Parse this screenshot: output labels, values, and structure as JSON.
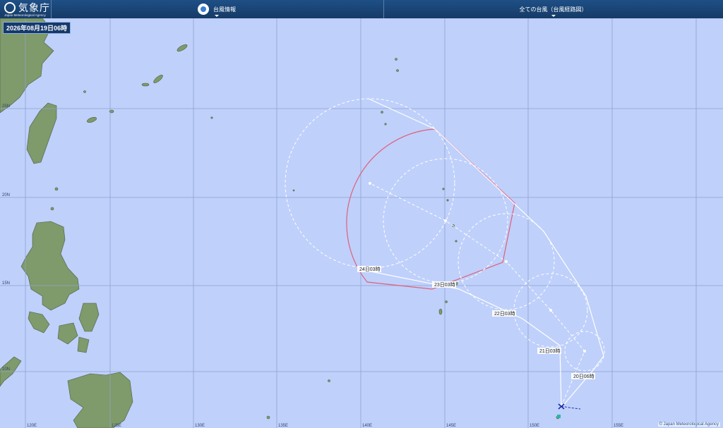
{
  "header": {
    "logo_ja": "気象庁",
    "logo_en": "Japan Meteorological Agency",
    "nav_typhoon_info": "台風情報",
    "nav_all_typhoons": "全ての台風（台風経路図）"
  },
  "timestamp": "2026年08月19日06時",
  "credit": "© Japan Meteorological Agency",
  "map": {
    "lon_labels": [
      "120E",
      "125E",
      "130E",
      "135E",
      "140E",
      "145E",
      "150E",
      "155E"
    ],
    "lat_labels": [
      "25N",
      "20N",
      "15N",
      "10N"
    ],
    "forecast_labels": [
      "24日03時",
      "23日03時",
      "22日03時",
      "21日03時",
      "20日06時"
    ],
    "colors": {
      "sea": "#bfd0fb",
      "land": "#7f9a6b",
      "grid": "#8da3cf",
      "forecast_line": "#ffffff",
      "storm_warning_area": "#e0607a"
    }
  }
}
